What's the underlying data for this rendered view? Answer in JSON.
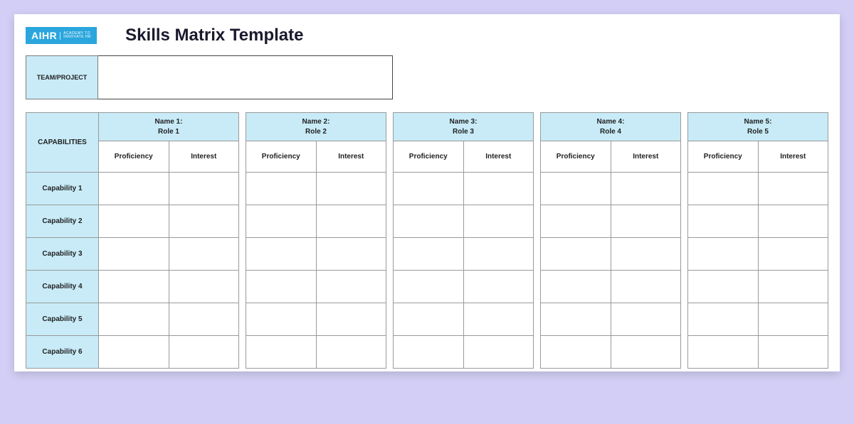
{
  "logo": {
    "main": "AIHR",
    "sub1": "ACADEMY TO",
    "sub2": "INNOVATE HR"
  },
  "title": "Skills Matrix Template",
  "team_label": "TEAM/PROJECT",
  "team_value": "",
  "headers": {
    "capabilities": "CAPABILITIES",
    "proficiency": "Proficiency",
    "interest": "Interest"
  },
  "people": [
    {
      "name": "Name 1:",
      "role": "Role 1"
    },
    {
      "name": "Name 2:",
      "role": "Role 2"
    },
    {
      "name": "Name 3:",
      "role": "Role 3"
    },
    {
      "name": "Name 4:",
      "role": "Role 4"
    },
    {
      "name": "Name 5:",
      "role": "Role 5"
    }
  ],
  "capabilities": [
    "Capability 1",
    "Capability 2",
    "Capability 3",
    "Capability 4",
    "Capability 5",
    "Capability 6"
  ]
}
